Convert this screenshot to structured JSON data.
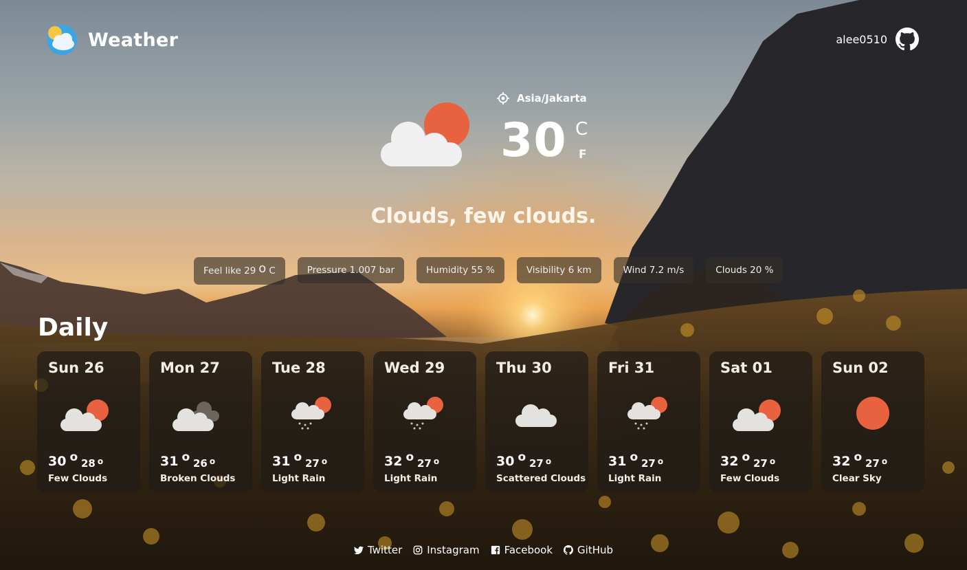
{
  "brand": {
    "title": "Weather"
  },
  "user": {
    "name": "alee0510"
  },
  "current": {
    "location": "Asia/Jakarta",
    "temperature": "30",
    "unit_c": "C",
    "unit_f": "F",
    "description": "Clouds, few clouds.",
    "icon": "cloud-sun-icon"
  },
  "stats": {
    "feel_label": "Feel like 29",
    "feel_unit": "C",
    "degree_symbol": "o",
    "pressure": "Pressure 1.007 bar",
    "humidity": "Humidity 55 %",
    "visibility": "Visibility 6 km",
    "wind": "Wind 7.2 m/s",
    "clouds": "Clouds 20 %"
  },
  "daily": {
    "title": "Daily",
    "days": [
      {
        "day": "Sun 26",
        "hi": "30",
        "lo": "28",
        "cond": "Few Clouds",
        "icon": "cloud-sun-icon"
      },
      {
        "day": "Mon 27",
        "hi": "31",
        "lo": "26",
        "cond": "Broken Clouds",
        "icon": "broken-clouds-icon"
      },
      {
        "day": "Tue 28",
        "hi": "31",
        "lo": "27",
        "cond": "Light Rain",
        "icon": "rain-sun-icon"
      },
      {
        "day": "Wed 29",
        "hi": "32",
        "lo": "27",
        "cond": "Light Rain",
        "icon": "rain-sun-icon"
      },
      {
        "day": "Thu 30",
        "hi": "30",
        "lo": "27",
        "cond": "Scattered Clouds",
        "icon": "cloud-icon"
      },
      {
        "day": "Fri 31",
        "hi": "31",
        "lo": "27",
        "cond": "Light Rain",
        "icon": "rain-sun-icon"
      },
      {
        "day": "Sat 01",
        "hi": "32",
        "lo": "27",
        "cond": "Few Clouds",
        "icon": "cloud-sun-icon"
      },
      {
        "day": "Sun 02",
        "hi": "32",
        "lo": "27",
        "cond": "Clear Sky",
        "icon": "sun-icon"
      }
    ]
  },
  "footer": {
    "links": [
      {
        "label": "Twitter",
        "icon": "twitter-icon"
      },
      {
        "label": "Instagram",
        "icon": "instagram-icon"
      },
      {
        "label": "Facebook",
        "icon": "facebook-icon"
      },
      {
        "label": "GitHub",
        "icon": "github-icon"
      }
    ]
  },
  "colors": {
    "sun": "#e8623f",
    "cloud": "#f0f0f0",
    "chip_bg": "#342f28"
  }
}
